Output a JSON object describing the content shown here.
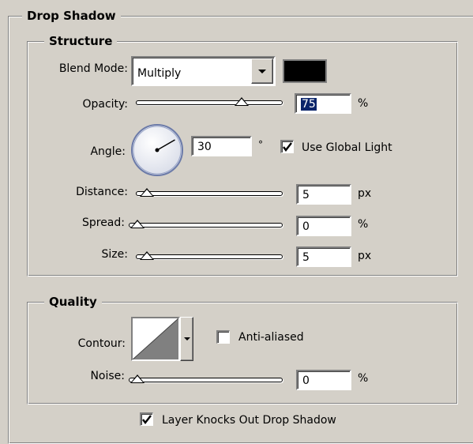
{
  "drop_shadow": {
    "title": "Drop Shadow",
    "structure": {
      "title": "Structure",
      "blend_mode": {
        "label": "Blend Mode:",
        "value": "Multiply",
        "color": "#000000"
      },
      "opacity": {
        "label": "Opacity:",
        "value": "75",
        "unit": "%",
        "level": 0.75
      },
      "angle": {
        "label": "Angle:",
        "value": "30",
        "unit": "°",
        "degrees": 30
      },
      "use_global_light": {
        "label": "Use Global Light",
        "checked": true
      },
      "distance": {
        "label": "Distance:",
        "value": "5",
        "unit": "px",
        "level": 0.02
      },
      "spread": {
        "label": "Spread:",
        "value": "0",
        "unit": "%",
        "level": 0
      },
      "size": {
        "label": "Size:",
        "value": "5",
        "unit": "px",
        "level": 0.02
      }
    },
    "quality": {
      "title": "Quality",
      "contour": {
        "label": "Contour:"
      },
      "anti_aliased": {
        "label": "Anti-aliased",
        "checked": false
      },
      "noise": {
        "label": "Noise:",
        "value": "0",
        "unit": "%",
        "level": 0
      }
    },
    "layer_knocks_out": {
      "label": "Layer Knocks Out Drop Shadow",
      "checked": true
    }
  }
}
